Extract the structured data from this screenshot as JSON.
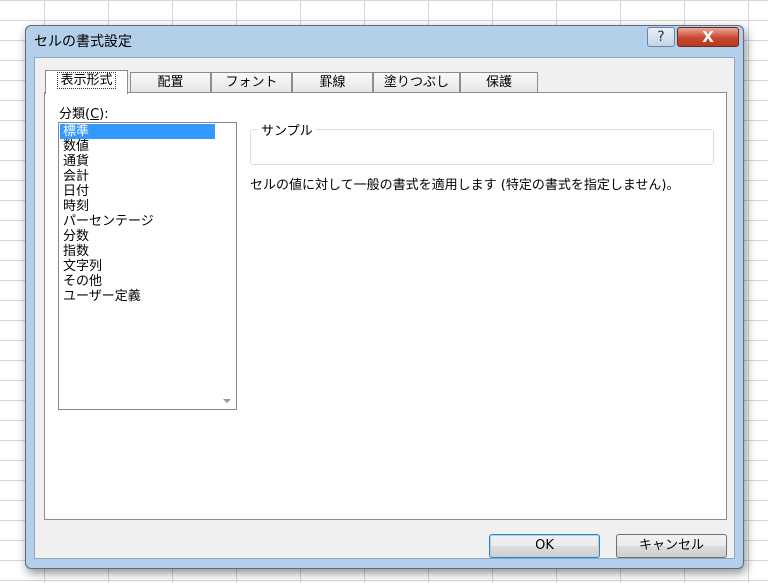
{
  "dialog": {
    "title": "セルの書式設定",
    "help_glyph": "?",
    "close_glyph": "X"
  },
  "tabs": [
    {
      "label": "表示形式",
      "active": true
    },
    {
      "label": "配置"
    },
    {
      "label": "フォント"
    },
    {
      "label": "罫線"
    },
    {
      "label": "塗りつぶし"
    },
    {
      "label": "保護"
    }
  ],
  "category": {
    "label_prefix": "分類(",
    "label_accel": "C",
    "label_suffix": "):",
    "items": [
      "標準",
      "数値",
      "通貨",
      "会計",
      "日付",
      "時刻",
      "パーセンテージ",
      "分数",
      "指数",
      "文字列",
      "その他",
      "ユーザー定義"
    ],
    "selected_index": 0
  },
  "sample": {
    "label": "サンプル",
    "value": ""
  },
  "description": "セルの値に対して一般の書式を適用します (特定の書式を指定しません)。",
  "buttons": {
    "ok": "OK",
    "cancel": "キャンセル"
  },
  "colors": {
    "frame": "#b4cfe9",
    "selection": "#3399ff",
    "close_button": "#c8462d"
  }
}
